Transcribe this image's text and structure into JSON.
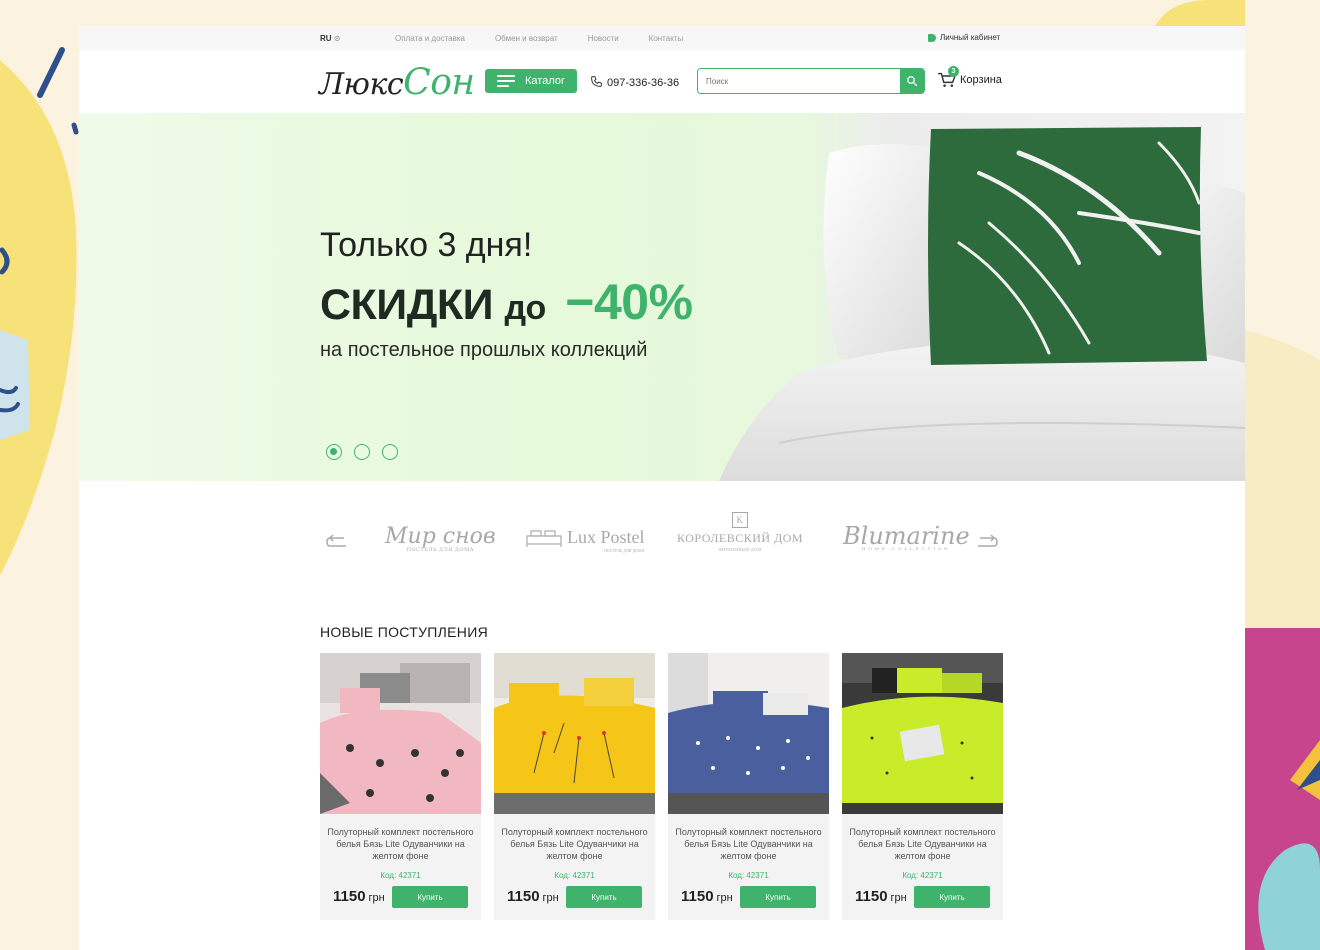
{
  "topbar": {
    "lang": "RU",
    "links": [
      "Оплата и доставка",
      "Обмен и возврат",
      "Новости",
      "Контакты"
    ],
    "account": "Личный кабинет"
  },
  "header": {
    "logo_part1": "Люкс",
    "logo_part2": "Сон",
    "catalog_label": "Каталог",
    "phone": "097-336-36-36",
    "search_placeholder": "Поиск",
    "cart_label": "Корзина",
    "cart_count": "3"
  },
  "hero": {
    "title1": "Только 3 дня!",
    "title2_bold": "СКИДКИ",
    "title2_small": "до",
    "title2_percent": "−40%",
    "subtitle": "на постельное прошлых коллекций",
    "active_slide": 1,
    "slides_count": 3
  },
  "brands": [
    {
      "name": "Мир снов",
      "sub": "ПОСТЕЛЬ ДЛЯ ДОМА"
    },
    {
      "name": "Lux Postel",
      "sub": "ПОСТЕЛЬ ДЛЯ ДОМА"
    },
    {
      "name": "КОРОЛЕВСКИЙ ДОМ",
      "sub": "ФИРМЕННЫЙ ДОМ"
    },
    {
      "name": "Blumarine",
      "sub": "HOME COLLECTION"
    }
  ],
  "new_arrivals": {
    "title": "НОВЫЕ ПОСТУПЛЕНИЯ",
    "products": [
      {
        "name": "Полуторный комплект постельного белья Бязь Lite Одуванчики на желтом фоне",
        "code": "Код: 42371",
        "price": "1150",
        "currency": "грн",
        "buy": "Купить",
        "color": "#f1b8c2"
      },
      {
        "name": "Полуторный комплект постельного белья Бязь Lite Одуванчики на желтом фоне",
        "code": "Код: 42371",
        "price": "1150",
        "currency": "грн",
        "buy": "Купить",
        "color": "#f5c518"
      },
      {
        "name": "Полуторный комплект постельного белья Бязь Lite Одуванчики на желтом фоне",
        "code": "Код: 42371",
        "price": "1150",
        "currency": "грн",
        "buy": "Купить",
        "color": "#4a5f9e"
      },
      {
        "name": "Полуторный комплект постельного белья Бязь Lite Одуванчики на желтом фоне",
        "code": "Код: 42371",
        "price": "1150",
        "currency": "грн",
        "buy": "Купить",
        "color": "#c8ec2a"
      }
    ]
  },
  "colors": {
    "accent": "#3fb36b",
    "page_bg": "#fbf3df"
  }
}
